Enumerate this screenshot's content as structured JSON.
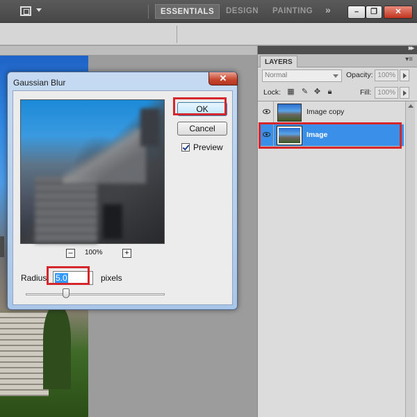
{
  "workspaces": {
    "essentials": "ESSENTIALS",
    "design": "DESIGN",
    "painting": "PAINTING",
    "more": "»"
  },
  "window_controls": {
    "minimize": "–",
    "restore": "❐",
    "close": "✕"
  },
  "dialog": {
    "title": "Gaussian Blur",
    "ok_label": "OK",
    "cancel_label": "Cancel",
    "preview_label": "Preview",
    "preview_checked": true,
    "zoom_out": "–",
    "zoom_in": "+",
    "zoom_level": "100%",
    "radius_label": "Radius:",
    "radius_value": "5.0",
    "radius_unit": "pixels",
    "close_glyph": "✕"
  },
  "layers_panel": {
    "tab_label": "LAYERS",
    "blend_mode": "Normal",
    "opacity_label": "Opacity:",
    "opacity_value": "100%",
    "lock_label": "Lock:",
    "fill_label": "Fill:",
    "fill_value": "100%",
    "layers": [
      {
        "name": "Image copy",
        "visible": true,
        "selected": false
      },
      {
        "name": "Image",
        "visible": true,
        "selected": true
      }
    ]
  },
  "colors": {
    "highlight": "#d5262c",
    "selection": "#3a8fe8",
    "app_chrome": "#474747"
  }
}
